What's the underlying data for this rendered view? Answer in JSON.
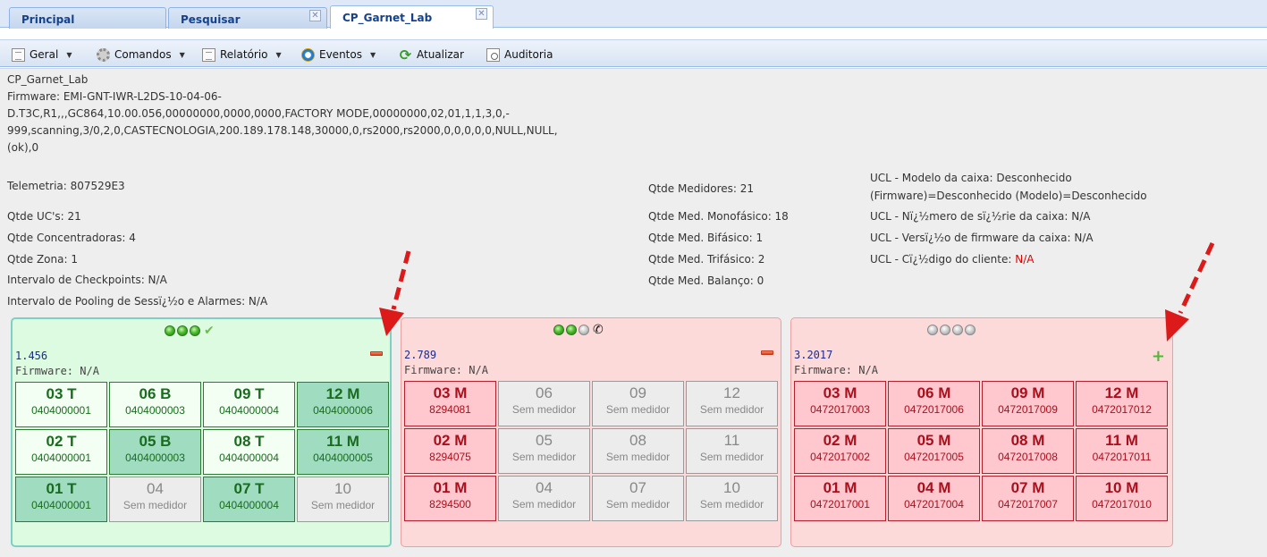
{
  "tabs": [
    {
      "label": "Principal",
      "closable": false,
      "active": false
    },
    {
      "label": "Pesquisar",
      "closable": true,
      "active": false
    },
    {
      "label": "CP_Garnet_Lab",
      "closable": true,
      "active": true
    }
  ],
  "toolbar": {
    "geral": "Geral",
    "comandos": "Comandos",
    "relatorio": "Relatório",
    "eventos": "Eventos",
    "atualizar": "Atualizar",
    "auditoria": "Auditoria"
  },
  "info": {
    "name": "CP_Garnet_Lab",
    "firmware_lines": [
      "Firmware: EMI-GNT-IWR-L2DS-10-04-06-",
      "D.T3C,R1,,,GC864,10.00.056,00000000,0000,0000,FACTORY MODE,00000000,02,01,1,1,3,0,-",
      "999,scanning,3/0,2,0,CASTECNOLOGIA,200.189.178.148,30000,0,rs2000,rs2000,0,0,0,0,0,NULL,NULL,",
      "(ok),0"
    ],
    "telemetria": "Telemetria: 807529E3",
    "qtde_ucs": "Qtde UC's: 21",
    "qtde_concentradoras": "Qtde Concentradoras: 4",
    "qtde_zona": "Qtde Zona: 1",
    "intervalo_checkpoints": "Intervalo de Checkpoints: N/A",
    "intervalo_pooling": "Intervalo de Pooling de Sessï¿½o e Alarmes: N/A",
    "qtde_medidores": "Qtde Medidores: 21",
    "qtde_mono": "Qtde Med. Monofásico: 18",
    "qtde_bi": "Qtde Med. Bifásico: 1",
    "qtde_tri": "Qtde Med. Trifásico: 2",
    "qtde_balanco": "Qtde Med. Balanço: 0",
    "ucl_modelo_1": "UCL - Modelo da caixa: Desconhecido",
    "ucl_modelo_2": "(Firmware)=Desconhecido (Modelo)=Desconhecido",
    "ucl_serie": "UCL - Nï¿½mero de sï¿½rie da caixa: N/A",
    "ucl_versao": "UCL - Versï¿½o de firmware da caixa: N/A",
    "ucl_codigo_label": "UCL - Cï¿½digo do cliente: ",
    "ucl_codigo_value": "N/A",
    "color_codigo": "#e00000"
  },
  "panels": [
    {
      "id": "1.456",
      "firmware": "Firmware: N/A",
      "theme": "green",
      "leds": [
        "on",
        "on",
        "on"
      ],
      "status_icon": "check-icon",
      "action": "minus",
      "rows": [
        [
          {
            "pos": "03 T",
            "num": "0404000001",
            "s": "ga"
          },
          {
            "pos": "06 B",
            "num": "0404000003",
            "s": "ga"
          },
          {
            "pos": "09 T",
            "num": "0404000004",
            "s": "ga"
          },
          {
            "pos": "12 M",
            "num": "0404000006",
            "s": "gb"
          }
        ],
        [
          {
            "pos": "02 T",
            "num": "0404000001",
            "s": "ga"
          },
          {
            "pos": "05 B",
            "num": "0404000003",
            "s": "gb"
          },
          {
            "pos": "08 T",
            "num": "0404000004",
            "s": "ga"
          },
          {
            "pos": "11 M",
            "num": "0404000005",
            "s": "gb"
          }
        ],
        [
          {
            "pos": "01 T",
            "num": "0404000001",
            "s": "gb"
          },
          {
            "pos": "04",
            "num": "Sem medidor",
            "s": "e"
          },
          {
            "pos": "07 T",
            "num": "0404000004",
            "s": "gb"
          },
          {
            "pos": "10",
            "num": "Sem medidor",
            "s": "e"
          }
        ]
      ]
    },
    {
      "id": "2.789",
      "firmware": "Firmware: N/A",
      "theme": "red",
      "leds": [
        "on",
        "on",
        "off"
      ],
      "status_icon": "phone-disconnected-icon",
      "action": "minus",
      "rows": [
        [
          {
            "pos": "03 M",
            "num": "8294081",
            "s": "r"
          },
          {
            "pos": "06",
            "num": "Sem medidor",
            "s": "e"
          },
          {
            "pos": "09",
            "num": "Sem medidor",
            "s": "e"
          },
          {
            "pos": "12",
            "num": "Sem medidor",
            "s": "e"
          }
        ],
        [
          {
            "pos": "02 M",
            "num": "8294075",
            "s": "r"
          },
          {
            "pos": "05",
            "num": "Sem medidor",
            "s": "e"
          },
          {
            "pos": "08",
            "num": "Sem medidor",
            "s": "e"
          },
          {
            "pos": "11",
            "num": "Sem medidor",
            "s": "e"
          }
        ],
        [
          {
            "pos": "01 M",
            "num": "8294500",
            "s": "r"
          },
          {
            "pos": "04",
            "num": "Sem medidor",
            "s": "e"
          },
          {
            "pos": "07",
            "num": "Sem medidor",
            "s": "e"
          },
          {
            "pos": "10",
            "num": "Sem medidor",
            "s": "e"
          }
        ]
      ]
    },
    {
      "id": "3.2017",
      "firmware": "Firmware: N/A",
      "theme": "red",
      "leds": [
        "off",
        "off",
        "off",
        "off"
      ],
      "status_icon": "",
      "action": "plus",
      "rows": [
        [
          {
            "pos": "03 M",
            "num": "0472017003",
            "s": "r"
          },
          {
            "pos": "06 M",
            "num": "0472017006",
            "s": "r"
          },
          {
            "pos": "09 M",
            "num": "0472017009",
            "s": "r"
          },
          {
            "pos": "12 M",
            "num": "0472017012",
            "s": "r"
          }
        ],
        [
          {
            "pos": "02 M",
            "num": "0472017002",
            "s": "r"
          },
          {
            "pos": "05 M",
            "num": "0472017005",
            "s": "r"
          },
          {
            "pos": "08 M",
            "num": "0472017008",
            "s": "r"
          },
          {
            "pos": "11 M",
            "num": "0472017011",
            "s": "r"
          }
        ],
        [
          {
            "pos": "01 M",
            "num": "0472017001",
            "s": "r"
          },
          {
            "pos": "04 M",
            "num": "0472017004",
            "s": "r"
          },
          {
            "pos": "07 M",
            "num": "0472017007",
            "s": "r"
          },
          {
            "pos": "10 M",
            "num": "0472017010",
            "s": "r"
          }
        ]
      ]
    }
  ],
  "annotation_color": "#dd1a1a"
}
